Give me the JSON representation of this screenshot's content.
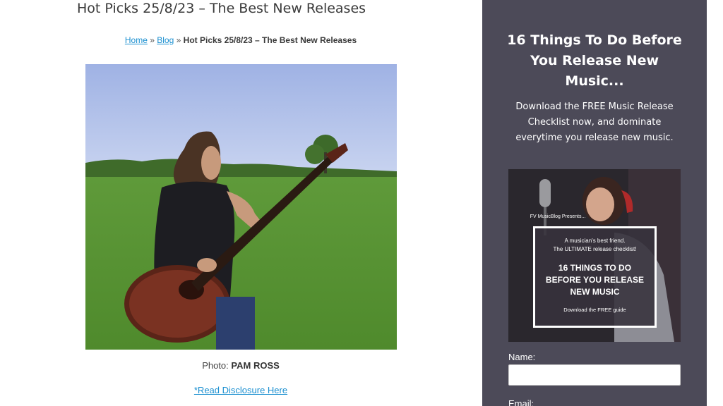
{
  "article": {
    "title": "Hot Picks 25/8/23 – The Best New Releases",
    "breadcrumb": {
      "home": "Home",
      "separator": "»",
      "blog": "Blog",
      "current": "Hot Picks 25/8/23 – The Best New Releases"
    },
    "photo_caption_label": "Photo:",
    "photo_caption_credit": "PAM ROSS",
    "disclosure_link": "*Read Disclosure Here"
  },
  "sidebar": {
    "title": "16 Things To Do Before You Release New Music...",
    "description": "Download the FREE Music Release Checklist now, and dominate everytime you release new music.",
    "promo": {
      "presents": "FV MusicBlog Presents...",
      "tagline_1": "A musician's best friend.",
      "tagline_2": "The ULTIMATE release checklist!",
      "headline_1": "16 THINGS TO DO",
      "headline_2": "BEFORE YOU RELEASE",
      "headline_3": "NEW MUSIC",
      "cta": "Download the FREE guide"
    },
    "form": {
      "name_label": "Name:",
      "email_label": "Email:"
    }
  },
  "colors": {
    "link": "#1a8fd0",
    "sidebar_bg": "#4c4a58"
  }
}
